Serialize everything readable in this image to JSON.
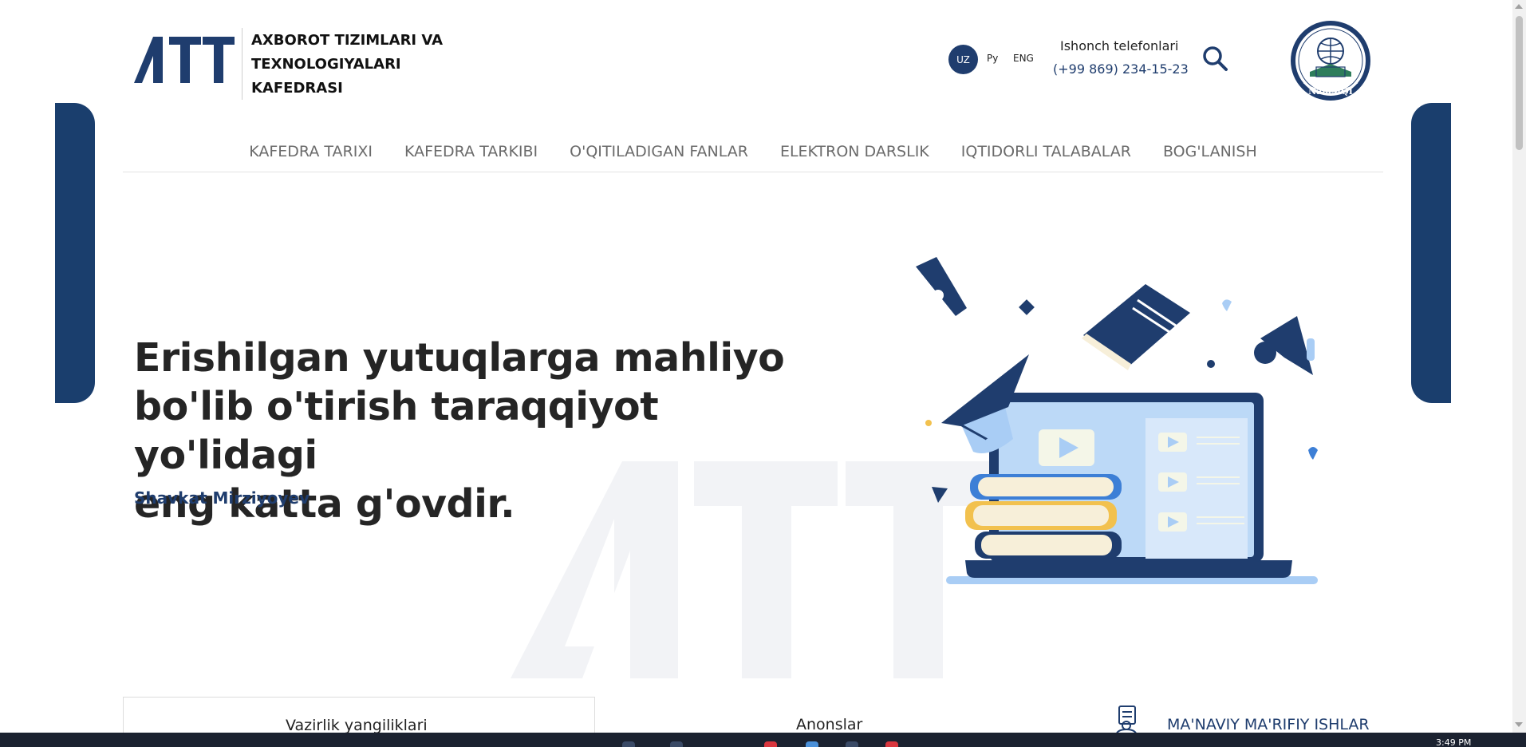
{
  "header": {
    "logo_alt": "ATT",
    "department_name": [
      "AXBOROT TIZIMLARI VA",
      "TEXNOLOGIYALARI",
      "KAFEDRASI"
    ],
    "languages": [
      "UZ",
      "Ру",
      "ENG"
    ],
    "active_language": "UZ",
    "hotline_label": "Ishonch telefonlari",
    "hotline_phone": "(+99 869) 234-15-23",
    "university_logo_text": "NamMQI"
  },
  "nav": {
    "items": [
      "KAFEDRA TARIXI",
      "KAFEDRA TARKIBI",
      "O'QITILADIGAN FANLAR",
      "ELEKTRON DARSLIK",
      "IQTIDORLI TALABALAR",
      "BOG'LANISH"
    ]
  },
  "hero": {
    "quote_lines": [
      "Erishilgan yutuqlarga mahliyo",
      "bo'lib o'tirish taraqqiyot yo'lidagi",
      "eng katta g'ovdir."
    ],
    "author": "Shavkat Mirziyoyev"
  },
  "sections": {
    "tabs": [
      "Vazirlik yangiliklari",
      "Anonslar",
      "MA'NAVIY MA'RIFIY ISHLAR"
    ]
  },
  "taskbar": {
    "clock": "3:49 PM"
  },
  "colors": {
    "brand_navy": "#1f3d6e",
    "side_block": "#1a3e6d",
    "illustration_light_blue": "#a9cdf5",
    "illustration_yellow": "#f2c14e"
  },
  "icons": [
    "att-logo-icon",
    "search-icon",
    "university-emblem-icon",
    "document-person-icon",
    "education-illustration"
  ]
}
